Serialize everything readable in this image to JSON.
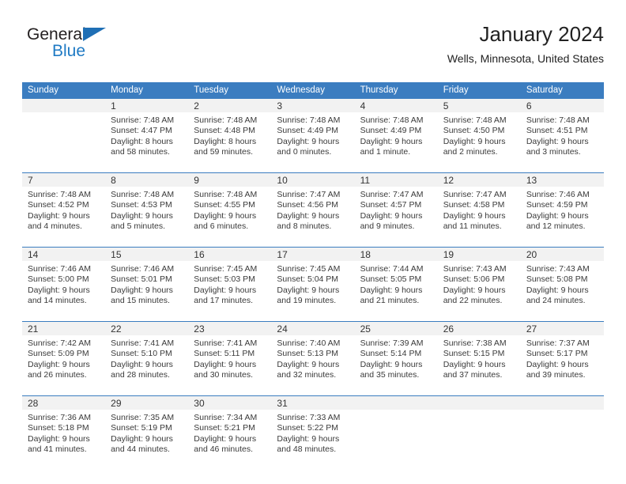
{
  "brand": {
    "name_top": "General",
    "name_bottom": "Blue",
    "triangle_color": "#1f6fb5",
    "blue_text_color": "#1f7ac4"
  },
  "header": {
    "title": "January 2024",
    "subtitle": "Wells, Minnesota, United States"
  },
  "theme": {
    "header_bg": "#3b7dc0",
    "header_text": "#ffffff",
    "daynum_bg": "#f2f2f2",
    "divider": "#3b7dc0",
    "body_text": "#3a3a3a"
  },
  "weekdays": [
    "Sunday",
    "Monday",
    "Tuesday",
    "Wednesday",
    "Thursday",
    "Friday",
    "Saturday"
  ],
  "labels": {
    "sunrise_prefix": "Sunrise: ",
    "sunset_prefix": "Sunset: ",
    "daylight_prefix": "Daylight: "
  },
  "weeks": [
    [
      {
        "num": "",
        "sunrise": "",
        "sunset": "",
        "daylight_line1": "",
        "daylight_line2": ""
      },
      {
        "num": "1",
        "sunrise": "Sunrise: 7:48 AM",
        "sunset": "Sunset: 4:47 PM",
        "daylight_line1": "Daylight: 8 hours",
        "daylight_line2": "and 58 minutes."
      },
      {
        "num": "2",
        "sunrise": "Sunrise: 7:48 AM",
        "sunset": "Sunset: 4:48 PM",
        "daylight_line1": "Daylight: 8 hours",
        "daylight_line2": "and 59 minutes."
      },
      {
        "num": "3",
        "sunrise": "Sunrise: 7:48 AM",
        "sunset": "Sunset: 4:49 PM",
        "daylight_line1": "Daylight: 9 hours",
        "daylight_line2": "and 0 minutes."
      },
      {
        "num": "4",
        "sunrise": "Sunrise: 7:48 AM",
        "sunset": "Sunset: 4:49 PM",
        "daylight_line1": "Daylight: 9 hours",
        "daylight_line2": "and 1 minute."
      },
      {
        "num": "5",
        "sunrise": "Sunrise: 7:48 AM",
        "sunset": "Sunset: 4:50 PM",
        "daylight_line1": "Daylight: 9 hours",
        "daylight_line2": "and 2 minutes."
      },
      {
        "num": "6",
        "sunrise": "Sunrise: 7:48 AM",
        "sunset": "Sunset: 4:51 PM",
        "daylight_line1": "Daylight: 9 hours",
        "daylight_line2": "and 3 minutes."
      }
    ],
    [
      {
        "num": "7",
        "sunrise": "Sunrise: 7:48 AM",
        "sunset": "Sunset: 4:52 PM",
        "daylight_line1": "Daylight: 9 hours",
        "daylight_line2": "and 4 minutes."
      },
      {
        "num": "8",
        "sunrise": "Sunrise: 7:48 AM",
        "sunset": "Sunset: 4:53 PM",
        "daylight_line1": "Daylight: 9 hours",
        "daylight_line2": "and 5 minutes."
      },
      {
        "num": "9",
        "sunrise": "Sunrise: 7:48 AM",
        "sunset": "Sunset: 4:55 PM",
        "daylight_line1": "Daylight: 9 hours",
        "daylight_line2": "and 6 minutes."
      },
      {
        "num": "10",
        "sunrise": "Sunrise: 7:47 AM",
        "sunset": "Sunset: 4:56 PM",
        "daylight_line1": "Daylight: 9 hours",
        "daylight_line2": "and 8 minutes."
      },
      {
        "num": "11",
        "sunrise": "Sunrise: 7:47 AM",
        "sunset": "Sunset: 4:57 PM",
        "daylight_line1": "Daylight: 9 hours",
        "daylight_line2": "and 9 minutes."
      },
      {
        "num": "12",
        "sunrise": "Sunrise: 7:47 AM",
        "sunset": "Sunset: 4:58 PM",
        "daylight_line1": "Daylight: 9 hours",
        "daylight_line2": "and 11 minutes."
      },
      {
        "num": "13",
        "sunrise": "Sunrise: 7:46 AM",
        "sunset": "Sunset: 4:59 PM",
        "daylight_line1": "Daylight: 9 hours",
        "daylight_line2": "and 12 minutes."
      }
    ],
    [
      {
        "num": "14",
        "sunrise": "Sunrise: 7:46 AM",
        "sunset": "Sunset: 5:00 PM",
        "daylight_line1": "Daylight: 9 hours",
        "daylight_line2": "and 14 minutes."
      },
      {
        "num": "15",
        "sunrise": "Sunrise: 7:46 AM",
        "sunset": "Sunset: 5:01 PM",
        "daylight_line1": "Daylight: 9 hours",
        "daylight_line2": "and 15 minutes."
      },
      {
        "num": "16",
        "sunrise": "Sunrise: 7:45 AM",
        "sunset": "Sunset: 5:03 PM",
        "daylight_line1": "Daylight: 9 hours",
        "daylight_line2": "and 17 minutes."
      },
      {
        "num": "17",
        "sunrise": "Sunrise: 7:45 AM",
        "sunset": "Sunset: 5:04 PM",
        "daylight_line1": "Daylight: 9 hours",
        "daylight_line2": "and 19 minutes."
      },
      {
        "num": "18",
        "sunrise": "Sunrise: 7:44 AM",
        "sunset": "Sunset: 5:05 PM",
        "daylight_line1": "Daylight: 9 hours",
        "daylight_line2": "and 21 minutes."
      },
      {
        "num": "19",
        "sunrise": "Sunrise: 7:43 AM",
        "sunset": "Sunset: 5:06 PM",
        "daylight_line1": "Daylight: 9 hours",
        "daylight_line2": "and 22 minutes."
      },
      {
        "num": "20",
        "sunrise": "Sunrise: 7:43 AM",
        "sunset": "Sunset: 5:08 PM",
        "daylight_line1": "Daylight: 9 hours",
        "daylight_line2": "and 24 minutes."
      }
    ],
    [
      {
        "num": "21",
        "sunrise": "Sunrise: 7:42 AM",
        "sunset": "Sunset: 5:09 PM",
        "daylight_line1": "Daylight: 9 hours",
        "daylight_line2": "and 26 minutes."
      },
      {
        "num": "22",
        "sunrise": "Sunrise: 7:41 AM",
        "sunset": "Sunset: 5:10 PM",
        "daylight_line1": "Daylight: 9 hours",
        "daylight_line2": "and 28 minutes."
      },
      {
        "num": "23",
        "sunrise": "Sunrise: 7:41 AM",
        "sunset": "Sunset: 5:11 PM",
        "daylight_line1": "Daylight: 9 hours",
        "daylight_line2": "and 30 minutes."
      },
      {
        "num": "24",
        "sunrise": "Sunrise: 7:40 AM",
        "sunset": "Sunset: 5:13 PM",
        "daylight_line1": "Daylight: 9 hours",
        "daylight_line2": "and 32 minutes."
      },
      {
        "num": "25",
        "sunrise": "Sunrise: 7:39 AM",
        "sunset": "Sunset: 5:14 PM",
        "daylight_line1": "Daylight: 9 hours",
        "daylight_line2": "and 35 minutes."
      },
      {
        "num": "26",
        "sunrise": "Sunrise: 7:38 AM",
        "sunset": "Sunset: 5:15 PM",
        "daylight_line1": "Daylight: 9 hours",
        "daylight_line2": "and 37 minutes."
      },
      {
        "num": "27",
        "sunrise": "Sunrise: 7:37 AM",
        "sunset": "Sunset: 5:17 PM",
        "daylight_line1": "Daylight: 9 hours",
        "daylight_line2": "and 39 minutes."
      }
    ],
    [
      {
        "num": "28",
        "sunrise": "Sunrise: 7:36 AM",
        "sunset": "Sunset: 5:18 PM",
        "daylight_line1": "Daylight: 9 hours",
        "daylight_line2": "and 41 minutes."
      },
      {
        "num": "29",
        "sunrise": "Sunrise: 7:35 AM",
        "sunset": "Sunset: 5:19 PM",
        "daylight_line1": "Daylight: 9 hours",
        "daylight_line2": "and 44 minutes."
      },
      {
        "num": "30",
        "sunrise": "Sunrise: 7:34 AM",
        "sunset": "Sunset: 5:21 PM",
        "daylight_line1": "Daylight: 9 hours",
        "daylight_line2": "and 46 minutes."
      },
      {
        "num": "31",
        "sunrise": "Sunrise: 7:33 AM",
        "sunset": "Sunset: 5:22 PM",
        "daylight_line1": "Daylight: 9 hours",
        "daylight_line2": "and 48 minutes."
      },
      {
        "num": "",
        "sunrise": "",
        "sunset": "",
        "daylight_line1": "",
        "daylight_line2": ""
      },
      {
        "num": "",
        "sunrise": "",
        "sunset": "",
        "daylight_line1": "",
        "daylight_line2": ""
      },
      {
        "num": "",
        "sunrise": "",
        "sunset": "",
        "daylight_line1": "",
        "daylight_line2": ""
      }
    ]
  ]
}
